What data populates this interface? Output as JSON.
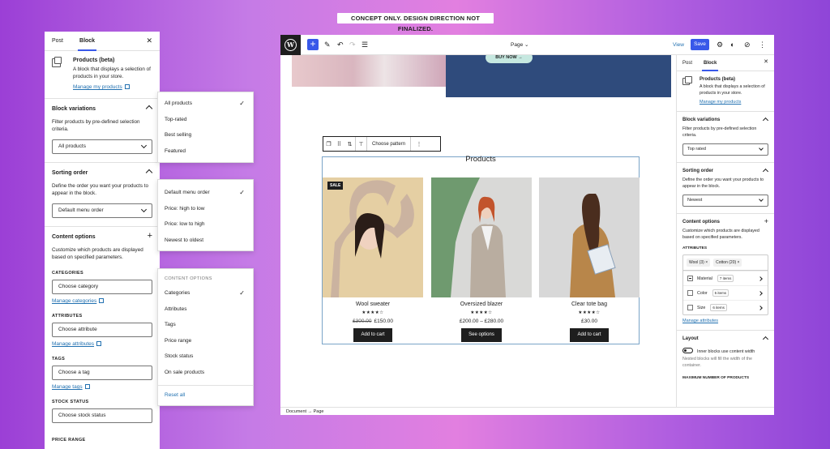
{
  "banner": "CONCEPT ONLY. DESIGN DIRECTION NOT FINALIZED.",
  "left": {
    "tabs": [
      "Post",
      "Block"
    ],
    "block_title": "Products (beta)",
    "block_desc": "A block that displays a selection of products in your store.",
    "manage_products": "Manage my products",
    "variations": {
      "title": "Block variations",
      "desc": "Filter products by pre-defined selection criteria.",
      "value": "All products"
    },
    "sorting": {
      "title": "Sorting order",
      "desc": "Define the order you want your products to appear in the block.",
      "value": "Default menu order"
    },
    "content": {
      "title": "Content options",
      "desc": "Customize which products are displayed based on specified parameters."
    },
    "categories": {
      "label": "CATEGORIES",
      "placeholder": "Choose category",
      "link": "Manage categories"
    },
    "attributes": {
      "label": "ATTRIBUTES",
      "placeholder": "Choose attribute",
      "link": "Manage attributes"
    },
    "tags": {
      "label": "TAGS",
      "placeholder": "Choose a tag",
      "link": "Manage tags"
    },
    "stock": {
      "label": "STOCK STATUS",
      "placeholder": "Choose stock status"
    },
    "price_range": "PRICE RANGE"
  },
  "menu1": [
    "All products",
    "Top-rated",
    "Best selling",
    "Featured"
  ],
  "menu2": [
    "Default menu order",
    "Price: high to low",
    "Price: low to high",
    "Newest to oldest"
  ],
  "menu3": {
    "header": "CONTENT OPTIONS",
    "items": [
      "Categories",
      "Attributes",
      "Tags",
      "Price range",
      "Stock status",
      "On sale products"
    ],
    "reset": "Reset all"
  },
  "toolbar": {
    "page": "Page",
    "view": "View",
    "save": "Save",
    "choose_pattern": "Choose pattern"
  },
  "canvas": {
    "buy_now": "BUY NOW →",
    "title": "Products",
    "products": [
      {
        "name": "Wool sweater",
        "stars": "★★★★☆",
        "old_price": "£300.00",
        "price": "£150.00",
        "button": "Add to cart",
        "badge": "SALE"
      },
      {
        "name": "Oversized blazer",
        "stars": "★★★★☆",
        "price": "£200.00 – £280.00",
        "button": "See options"
      },
      {
        "name": "Clear tote bag",
        "stars": "★★★★☆",
        "price": "£30.00",
        "button": "Add to cart"
      }
    ]
  },
  "crumbs": "Document  →  Page",
  "right": {
    "tabs": [
      "Post",
      "Block"
    ],
    "block_title": "Products (beta)",
    "block_desc": "A block that displays a selection of products in your store.",
    "manage_products": "Manage my products",
    "variations": {
      "title": "Block variations",
      "desc": "Filter products by pre-defined selection criteria.",
      "value": "Top rated"
    },
    "sorting": {
      "title": "Sorting order",
      "desc": "Define the order you want your products to appear in the block.",
      "value": "Newest"
    },
    "content": {
      "title": "Content options",
      "desc": "Customize which products are displayed based on specified parameters."
    },
    "attributes_label": "ATTRIBUTES",
    "tags": [
      "Wool (3)  ×",
      "Cotton (20)  ×"
    ],
    "rows": [
      {
        "name": "Material",
        "count": "7 items"
      },
      {
        "name": "Color",
        "count": "5 items"
      },
      {
        "name": "Size",
        "count": "6 items"
      }
    ],
    "manage_attributes": "Manage attributes",
    "layout": {
      "title": "Layout",
      "toggle": "Inner blocks use content width",
      "desc": "Nested blocks will fill the width of the container.",
      "max": "MAXIMUM NUMBER OF PRODUCTS"
    }
  }
}
